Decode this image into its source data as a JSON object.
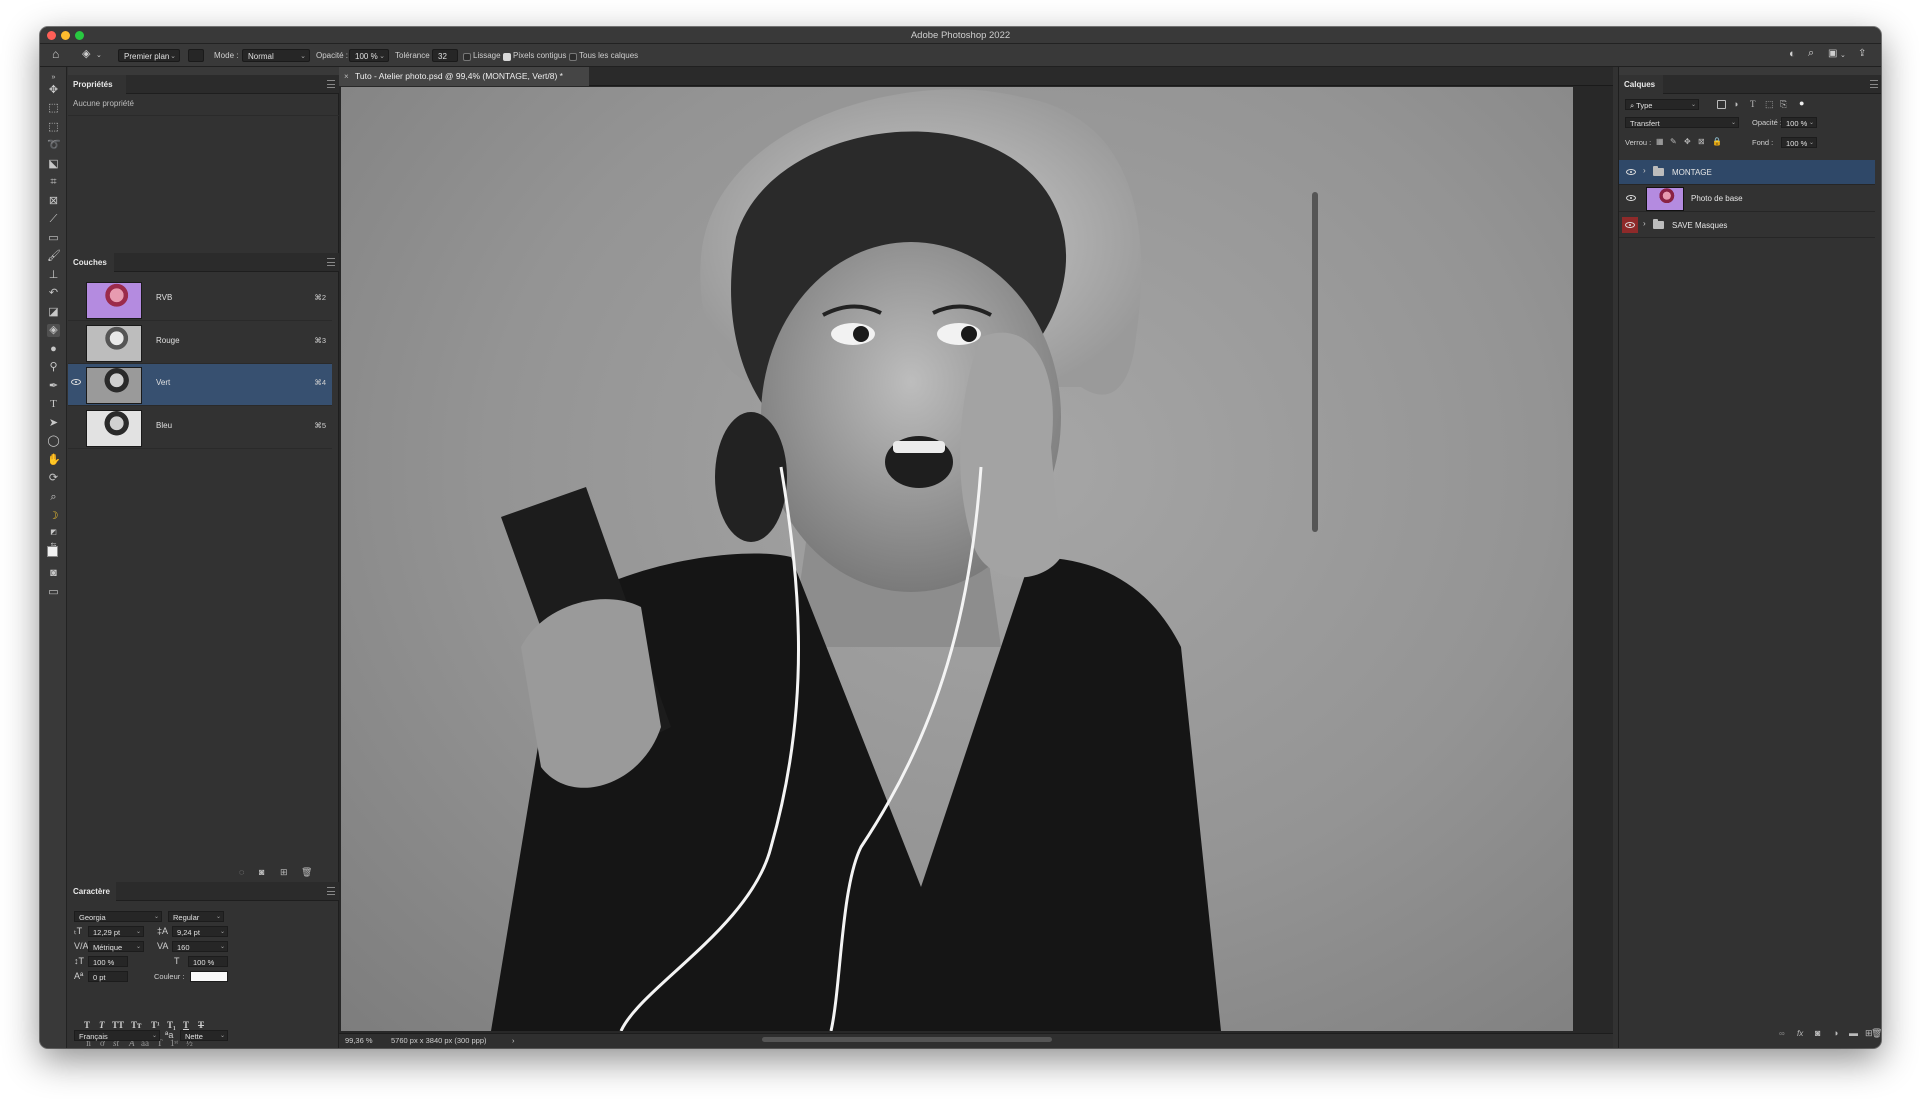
{
  "app_title": "Adobe Photoshop 2022",
  "options_bar": {
    "fill_source": "Premier plan",
    "mode_label": "Mode :",
    "mode_value": "Normal",
    "opacity_label": "Opacité :",
    "opacity_value": "100 %",
    "tolerance_label": "Tolérance :",
    "tolerance_value": "32",
    "smoothing_label": "Lissage",
    "contiguous_label": "Pixels contigus",
    "all_layers_label": "Tous les calques"
  },
  "properties": {
    "title": "Propriétés",
    "empty_text": "Aucune propriété"
  },
  "channels": {
    "title": "Couches",
    "items": [
      {
        "name": "RVB",
        "shortcut": "⌘2"
      },
      {
        "name": "Rouge",
        "shortcut": "⌘3"
      },
      {
        "name": "Vert",
        "shortcut": "⌘4"
      },
      {
        "name": "Bleu",
        "shortcut": "⌘5"
      }
    ]
  },
  "character": {
    "title": "Caractère",
    "font_family": "Georgia",
    "font_style": "Regular",
    "font_size": "12,29 pt",
    "leading": "9,24 pt",
    "kerning": "Métrique",
    "tracking": "160",
    "vertical_scale": "100 %",
    "horizontal_scale": "100 %",
    "baseline_shift": "0 pt",
    "color_label": "Couleur :",
    "language": "Français",
    "antialias": "Nette"
  },
  "document": {
    "tab_title": "Tuto - Atelier photo.psd @ 99,4% (MONTAGE, Vert/8) *",
    "zoom": "99,36 %",
    "doc_info": "5760 px x 3840 px (300 ppp)"
  },
  "layers": {
    "title": "Calques",
    "filter_kind": "Type",
    "blend_mode": "Transfert",
    "opacity_label": "Opacité :",
    "opacity_value": "100 %",
    "lock_label": "Verrou :",
    "fill_label": "Fond :",
    "fill_value": "100 %",
    "items": [
      {
        "name": "MONTAGE",
        "type": "group"
      },
      {
        "name": "Photo de base",
        "type": "pixel"
      },
      {
        "name": "SAVE Masques",
        "type": "group"
      }
    ]
  },
  "colors": {
    "selection": "#375070",
    "panel_bg": "#323232",
    "accent_red": "#8e2a2a"
  }
}
